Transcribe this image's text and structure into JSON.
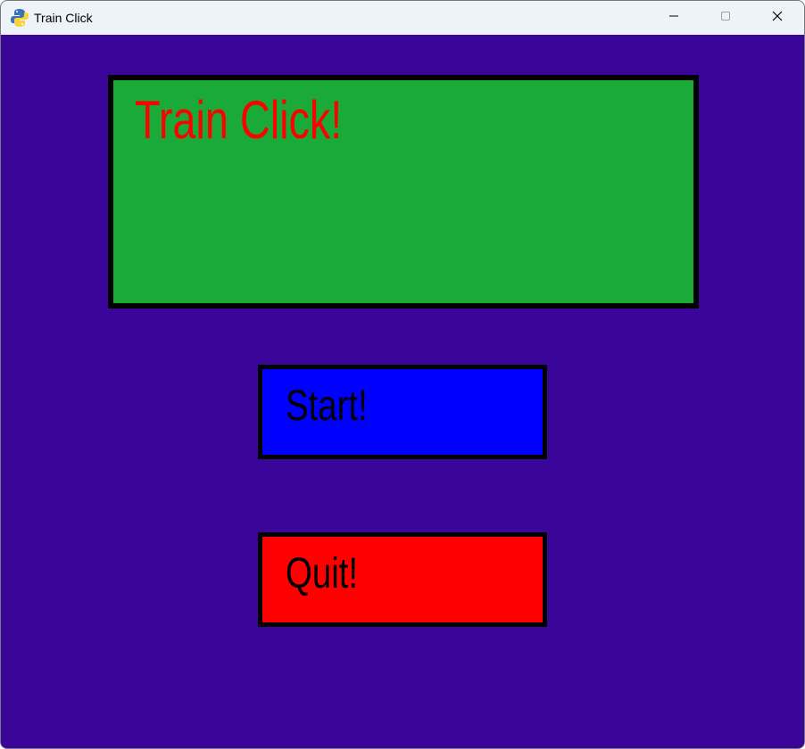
{
  "window": {
    "title": "Train Click",
    "app_icon": "python-icon",
    "controls": {
      "minimize_icon": "minimize-icon",
      "maximize_icon": "maximize-icon",
      "close_icon": "close-icon"
    }
  },
  "game": {
    "background_color": "#3a0599",
    "banner": {
      "text": "Train Click!",
      "box_color": "#1aaa37",
      "text_color": "#ff0000"
    },
    "buttons": [
      {
        "label": "Start!",
        "color": "#0000ff"
      },
      {
        "label": "Quit!",
        "color": "#ff0000"
      }
    ]
  }
}
